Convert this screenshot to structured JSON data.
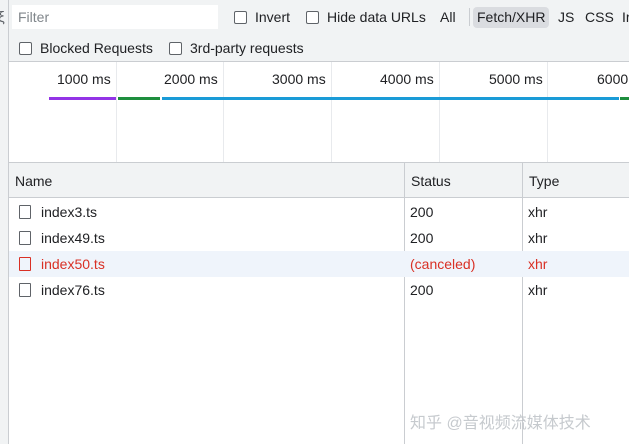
{
  "filter_bar": {
    "placeholder": "Filter",
    "invert_label": "Invert",
    "hide_data_urls_label": "Hide data URLs",
    "type_filters": [
      "All",
      "Fetch/XHR",
      "JS",
      "CSS",
      "Ir"
    ],
    "active_type_filter": "Fetch/XHR"
  },
  "options_bar": {
    "blocked_requests_label": "Blocked Requests",
    "third_party_label": "3rd-party requests"
  },
  "timeline": {
    "ticks": [
      "1000 ms",
      "2000 ms",
      "3000 ms",
      "4000 ms",
      "5000 ms",
      "6000"
    ],
    "bar_colors": {
      "waiting": "#9334e6",
      "content": "#1e8e3e",
      "download": "#1a9bd7"
    }
  },
  "table": {
    "columns": [
      "Name",
      "Status",
      "Type"
    ],
    "rows": [
      {
        "name": "index3.ts",
        "status": "200",
        "type": "xhr",
        "error": false
      },
      {
        "name": "index49.ts",
        "status": "200",
        "type": "xhr",
        "error": false
      },
      {
        "name": "index50.ts",
        "status": "(canceled)",
        "type": "xhr",
        "error": true
      },
      {
        "name": "index76.ts",
        "status": "200",
        "type": "xhr",
        "error": false
      }
    ]
  },
  "watermark": "知乎 @音视频流媒体技术",
  "colors": {
    "error_text": "#d93025",
    "error_row_bg": "#eff4fb",
    "toolbar_bg": "#f1f3f4",
    "active_filter_bg": "#dadce0"
  }
}
